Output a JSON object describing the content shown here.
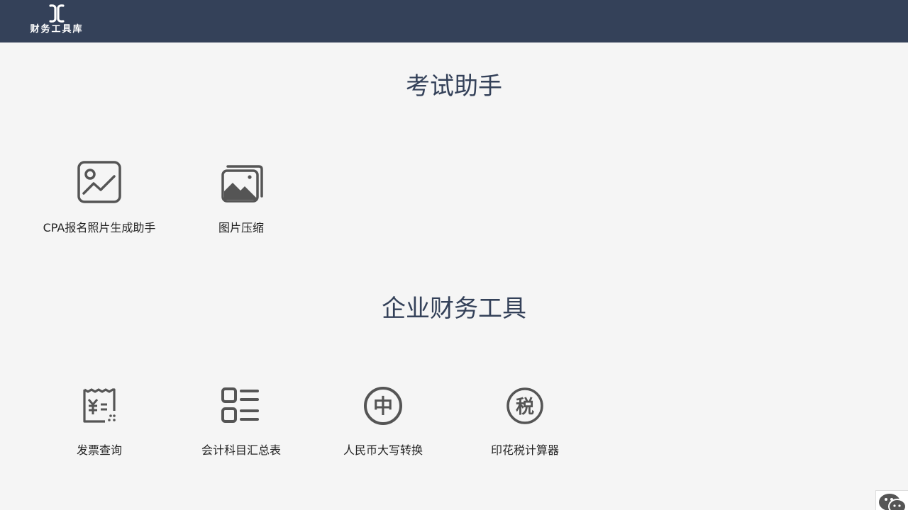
{
  "header": {
    "logo_text": "财务工具库"
  },
  "sections": [
    {
      "title": "考试助手",
      "tools": [
        {
          "label": "CPA报名照片生成助手",
          "icon": "photo-chart-icon"
        },
        {
          "label": "图片压缩",
          "icon": "image-stack-icon"
        }
      ]
    },
    {
      "title": "企业财务工具",
      "tools": [
        {
          "label": "发票查询",
          "icon": "invoice-icon"
        },
        {
          "label": "会计科目汇总表",
          "icon": "list-summary-icon"
        },
        {
          "label": "人民币大写转换",
          "icon": "zhong-circle-icon",
          "glyph": "中"
        },
        {
          "label": "印花税计算器",
          "icon": "tax-circle-icon",
          "glyph": "税"
        }
      ]
    }
  ],
  "floating": {
    "icon": "wechat-icon"
  },
  "colors": {
    "header_bg": "#344159",
    "page_bg": "#f5f5f5",
    "title": "#344159",
    "icon": "#555555"
  }
}
